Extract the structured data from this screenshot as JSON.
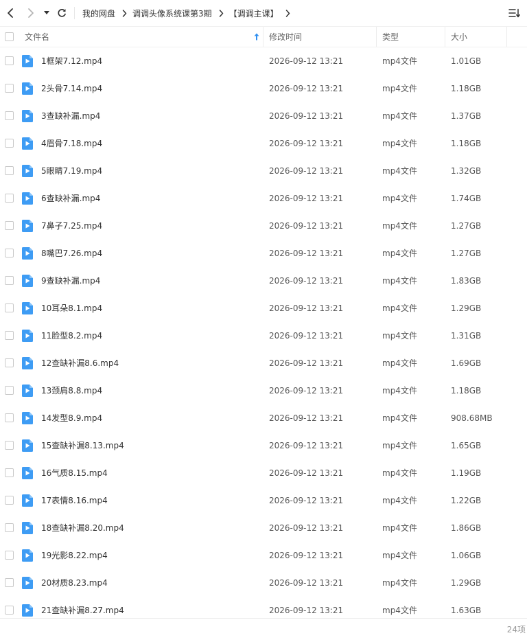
{
  "nav": {
    "back_icon": "chevron-left-icon",
    "forward_icon": "chevron-right-icon",
    "history_icon": "caret-down-icon",
    "refresh_icon": "refresh-icon",
    "view_toggle_icon": "sort-list-icon"
  },
  "breadcrumb": [
    {
      "label": "我的网盘"
    },
    {
      "label": "调调头像系统课第3期"
    },
    {
      "label": "【调调主课】"
    }
  ],
  "columns": {
    "name": "文件名",
    "modified": "修改时间",
    "type": "类型",
    "size": "大小"
  },
  "sort": {
    "column": "name",
    "direction": "asc",
    "icon": "arrow-up-icon"
  },
  "colors": {
    "accent": "#2f8ff0",
    "file_icon": "#3e9cf4"
  },
  "files": [
    {
      "name": "1框架7.12.mp4",
      "modified": "2026-09-12 13:21",
      "type": "mp4文件",
      "size": "1.01GB"
    },
    {
      "name": "2头骨7.14.mp4",
      "modified": "2026-09-12 13:21",
      "type": "mp4文件",
      "size": "1.18GB"
    },
    {
      "name": "3查缺补漏.mp4",
      "modified": "2026-09-12 13:21",
      "type": "mp4文件",
      "size": "1.37GB"
    },
    {
      "name": "4眉骨7.18.mp4",
      "modified": "2026-09-12 13:21",
      "type": "mp4文件",
      "size": "1.18GB"
    },
    {
      "name": "5眼睛7.19.mp4",
      "modified": "2026-09-12 13:21",
      "type": "mp4文件",
      "size": "1.32GB"
    },
    {
      "name": "6查缺补漏.mp4",
      "modified": "2026-09-12 13:21",
      "type": "mp4文件",
      "size": "1.74GB"
    },
    {
      "name": "7鼻子7.25.mp4",
      "modified": "2026-09-12 13:21",
      "type": "mp4文件",
      "size": "1.27GB"
    },
    {
      "name": "8嘴巴7.26.mp4",
      "modified": "2026-09-12 13:21",
      "type": "mp4文件",
      "size": "1.27GB"
    },
    {
      "name": "9查缺补漏.mp4",
      "modified": "2026-09-12 13:21",
      "type": "mp4文件",
      "size": "1.83GB"
    },
    {
      "name": "10耳朵8.1.mp4",
      "modified": "2026-09-12 13:21",
      "type": "mp4文件",
      "size": "1.29GB"
    },
    {
      "name": "11脸型8.2.mp4",
      "modified": "2026-09-12 13:21",
      "type": "mp4文件",
      "size": "1.31GB"
    },
    {
      "name": "12查缺补漏8.6.mp4",
      "modified": "2026-09-12 13:21",
      "type": "mp4文件",
      "size": "1.69GB"
    },
    {
      "name": "13颈肩8.8.mp4",
      "modified": "2026-09-12 13:21",
      "type": "mp4文件",
      "size": "1.18GB"
    },
    {
      "name": "14发型8.9.mp4",
      "modified": "2026-09-12 13:21",
      "type": "mp4文件",
      "size": "908.68MB"
    },
    {
      "name": "15查缺补漏8.13.mp4",
      "modified": "2026-09-12 13:21",
      "type": "mp4文件",
      "size": "1.65GB"
    },
    {
      "name": "16气质8.15.mp4",
      "modified": "2026-09-12 13:21",
      "type": "mp4文件",
      "size": "1.19GB"
    },
    {
      "name": "17表情8.16.mp4",
      "modified": "2026-09-12 13:21",
      "type": "mp4文件",
      "size": "1.22GB"
    },
    {
      "name": "18查缺补漏8.20.mp4",
      "modified": "2026-09-12 13:21",
      "type": "mp4文件",
      "size": "1.86GB"
    },
    {
      "name": "19光影8.22.mp4",
      "modified": "2026-09-12 13:21",
      "type": "mp4文件",
      "size": "1.06GB"
    },
    {
      "name": "20材质8.23.mp4",
      "modified": "2026-09-12 13:21",
      "type": "mp4文件",
      "size": "1.29GB"
    },
    {
      "name": "21查缺补漏8.27.mp4",
      "modified": "2026-09-12 13:21",
      "type": "mp4文件",
      "size": "1.63GB"
    }
  ],
  "footer": {
    "count_label": "24项"
  }
}
